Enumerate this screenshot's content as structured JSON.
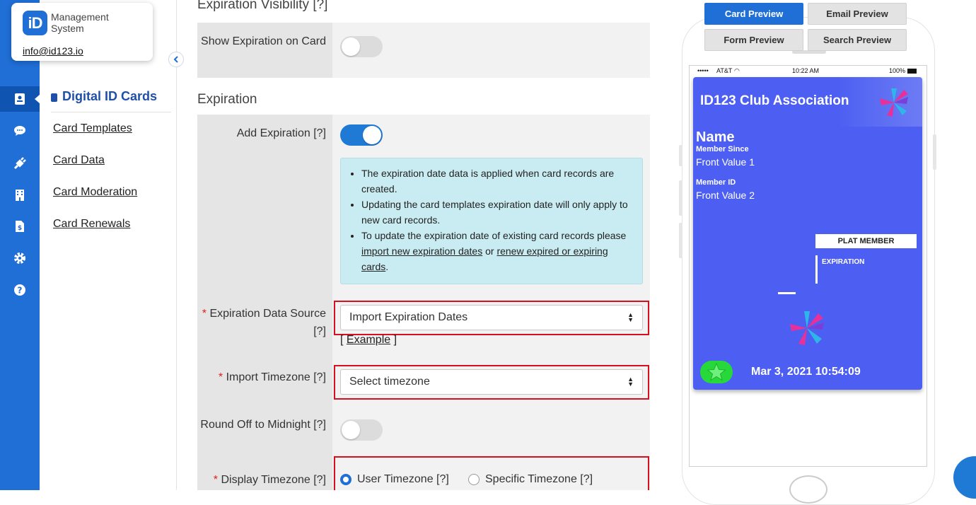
{
  "brand": {
    "name_line1": "Management",
    "name_line2": "System",
    "badge_text": "iD",
    "email": "info@id123.io"
  },
  "rail": {
    "items": [
      "id-card-icon",
      "chat-icon",
      "plug-icon",
      "building-icon",
      "invoice-icon",
      "gear-icon",
      "help-icon"
    ],
    "active": 0
  },
  "subnav": {
    "heading": "Digital ID Cards",
    "links": [
      "Card Templates",
      "Card Data",
      "Card Moderation",
      "Card Renewals"
    ]
  },
  "form": {
    "visibility_section": "Expiration Visibility [?]",
    "show_expiration_label": "Show Expiration on Card",
    "show_expiration_on": false,
    "expiration_section": "Expiration",
    "add_expiration_label": "Add Expiration [?]",
    "add_expiration_on": true,
    "info": {
      "bullet1": "The expiration date data is applied when card records are created.",
      "bullet2": "Updating the card templates expiration date will only apply to new card records.",
      "bullet3_pre": "To update the expiration date of existing card records please",
      "bullet3_link1": "import new expiration dates",
      "bullet3_mid": "or",
      "bullet3_link2": "renew expired or expiring cards",
      "bullet3_post": "."
    },
    "data_source_label": "Expiration Data Source [?]",
    "data_source_value": "Import Expiration Dates",
    "example_open": "[",
    "example_link": "Example",
    "example_close": "]",
    "import_tz_label": "Import Timezone [?]",
    "import_tz_value": "Select timezone",
    "round_label": "Round Off to Midnight [?]",
    "round_on": false,
    "display_tz_label": "Display Timezone [?]",
    "display_tz_options": [
      "User Timezone [?]",
      "Specific Timezone [?]"
    ],
    "display_tz_selected": 0,
    "required_mark": "*"
  },
  "preview": {
    "buttons": [
      "Card Preview",
      "Email Preview",
      "Form Preview",
      "Search Preview"
    ],
    "active": "Card Preview",
    "status": {
      "carrier": "AT&T",
      "time": "10:22 AM",
      "battery": "100%"
    },
    "card": {
      "org": "ID123 Club Association",
      "name": "Name",
      "field1_label": "Member Since",
      "field1_value": "Front Value 1",
      "field2_label": "Member ID",
      "field2_value": "Front Value 2",
      "badge": "PLAT MEMBER",
      "expiration_label": "EXPIRATION",
      "datetime": "Mar 3, 2021  10:54:09",
      "bg_color": "#4d5ff2"
    }
  },
  "colors": {
    "accent": "#1f6fd6",
    "highlight": "#d6101e",
    "info_bg": "#c9ecf2"
  }
}
